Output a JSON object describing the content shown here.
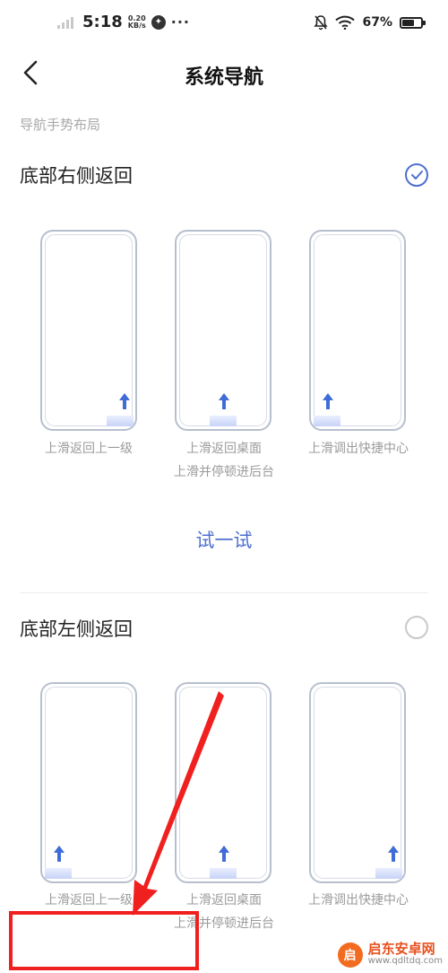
{
  "status_bar": {
    "time": "5:18",
    "net_speed_value": "0.20",
    "net_speed_unit": "KB/s",
    "more": "···",
    "battery_text": "67%",
    "battery_level": 0.67
  },
  "header": {
    "title": "系统导航"
  },
  "section": {
    "label": "导航手势布局"
  },
  "options": [
    {
      "title": "底部右侧返回",
      "selected": true,
      "captions": [
        "上滑返回上一级",
        "上滑返回桌面",
        "上滑调出快捷中心"
      ],
      "caption_second_line": "上滑并停顿进后台"
    },
    {
      "title": "底部左侧返回",
      "selected": false,
      "captions": [
        "上滑返回上一级",
        "上滑返回桌面",
        "上滑调出快捷中心"
      ],
      "caption_second_line": "上滑并停顿进后台"
    }
  ],
  "try_button": {
    "label": "试一试"
  },
  "watermark": {
    "logo_text": "启",
    "name": "启东安卓网",
    "url": "www.qdltdq.com"
  },
  "colors": {
    "accent": "#4f6fd0",
    "annotation": "#f0201f"
  }
}
